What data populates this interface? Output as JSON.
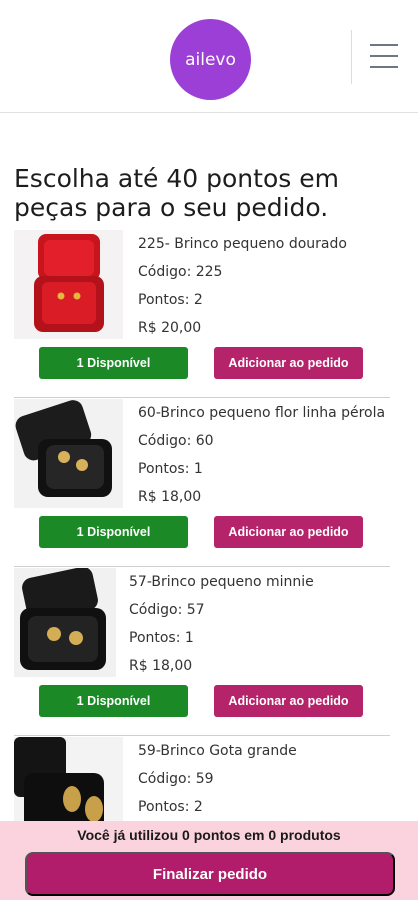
{
  "header": {
    "logo_text": "ailevo"
  },
  "heading": "Escolha até 40 pontos em peças para o seu pedido.",
  "products": [
    {
      "title": "225- Brinco pequeno dourado",
      "code": "Código: 225",
      "points": "Pontos: 2",
      "price": "R$ 20,00",
      "available_label": "1 Disponível",
      "add_label": "Adicionar ao pedido"
    },
    {
      "title": "60-Brinco pequeno flor linha pérola",
      "code": "Código: 60",
      "points": "Pontos: 1",
      "price": "R$ 18,00",
      "available_label": "1 Disponível",
      "add_label": "Adicionar ao pedido"
    },
    {
      "title": "57-Brinco pequeno minnie",
      "code": "Código: 57",
      "points": "Pontos: 1",
      "price": "R$ 18,00",
      "available_label": "1 Disponível",
      "add_label": "Adicionar ao pedido"
    },
    {
      "title": "59-Brinco Gota grande",
      "code": "Código: 59",
      "points": "Pontos: 2",
      "price": "",
      "available_label": "",
      "add_label": ""
    }
  ],
  "footer": {
    "summary": "Você já utilizou 0 pontos em 0 produtos",
    "finish_label": "Finalizar pedido"
  },
  "colors": {
    "brand_purple": "#9b3fd6",
    "available_green": "#1b8a26",
    "add_magenta": "#b5236a",
    "footer_bg": "#fbd3de"
  }
}
